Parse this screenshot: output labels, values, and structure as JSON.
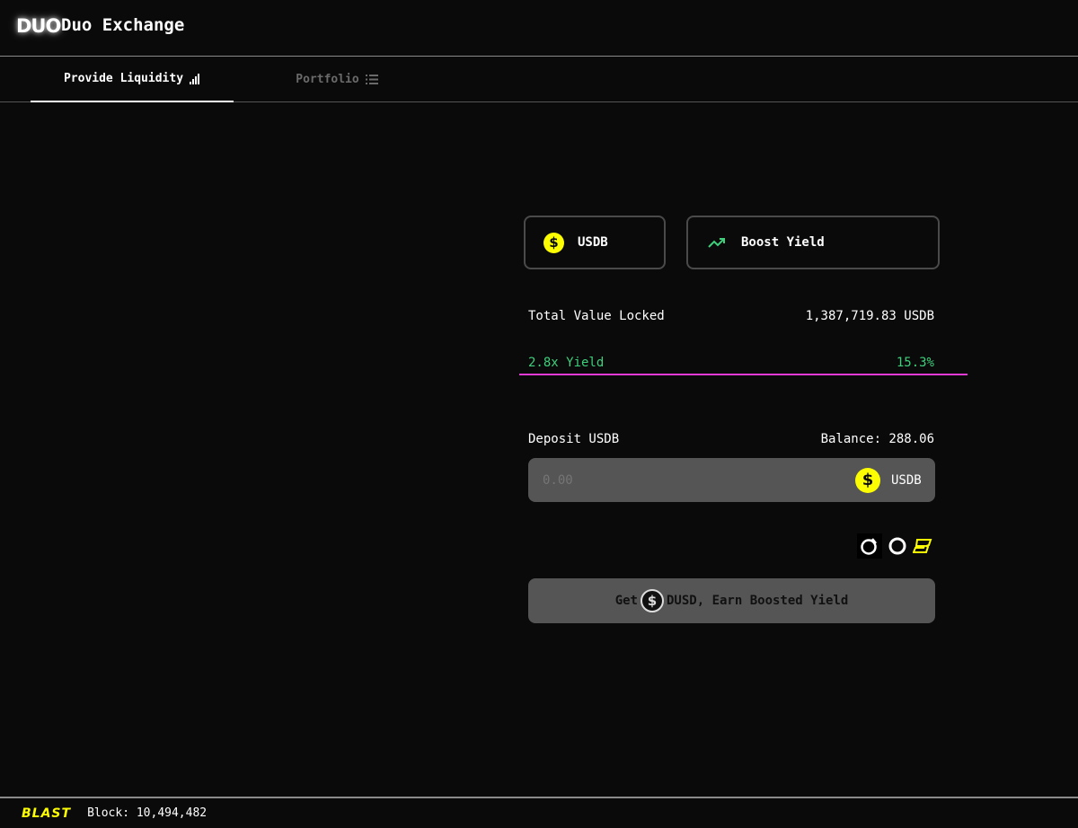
{
  "header": {
    "logo_text": "DUO",
    "title": "Duo Exchange"
  },
  "tabs": [
    {
      "label": "Provide Liquidity",
      "icon": "bar-chart-icon",
      "active": true
    },
    {
      "label": "Portfolio",
      "icon": "list-icon",
      "active": false
    }
  ],
  "selector": {
    "token_label": "USDB",
    "token_icon": "usdb-coin-icon",
    "mode_label": "Boost Yield",
    "mode_icon": "trending-up-icon"
  },
  "stats": {
    "tvl_label": "Total Value Locked",
    "tvl_value": "1,387,719.83 USDB",
    "yield_label": "2.8x Yield",
    "yield_value": "15.3%"
  },
  "deposit": {
    "label": "Deposit USDB",
    "balance": "Balance: 288.06",
    "placeholder": "0.00",
    "unit": "USDB"
  },
  "partner_icons": [
    "orbit-icon",
    "ring-icon",
    "blast-b-icon"
  ],
  "cta": {
    "prefix": "Get",
    "suffix": "DUSD, Earn Boosted Yield",
    "icon": "dusd-coin-icon"
  },
  "footer": {
    "logo_text": "BLAST",
    "block": "Block: 10,494,482"
  },
  "colors": {
    "background": "#0a0a0a",
    "accent_yellow": "#fcfc03",
    "yield_green": "#3ecf7c",
    "yield_line": "#e23ad4",
    "input_bg": "#555555"
  }
}
